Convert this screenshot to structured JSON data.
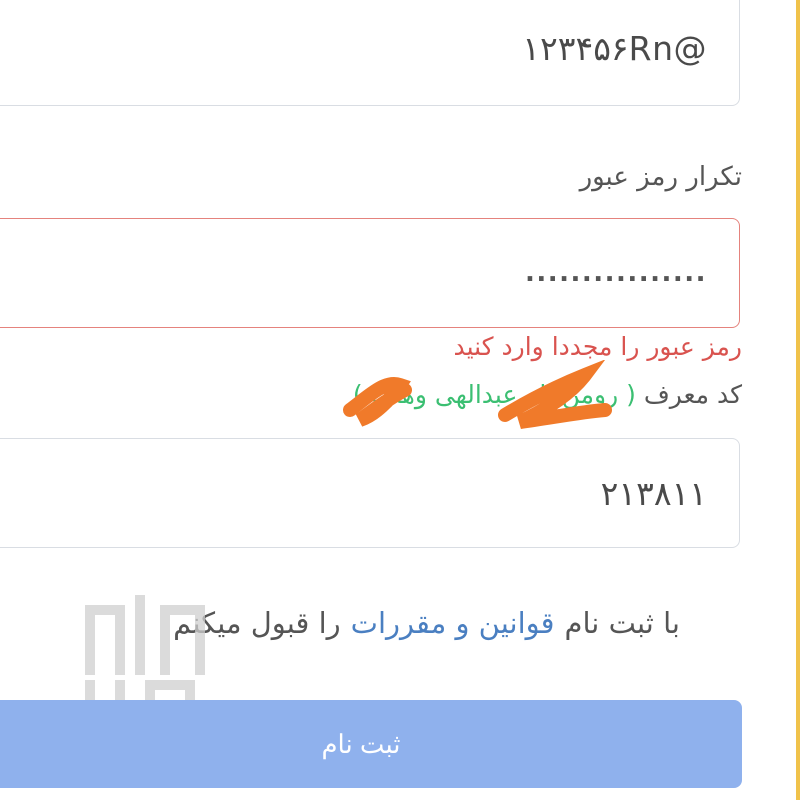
{
  "password": {
    "value": "۱۲۳۴۵۶Rn@"
  },
  "confirm_password": {
    "label": "تکرار رمز عبور",
    "value": "................",
    "error": "رمز عبور را مجددا وارد کنید"
  },
  "referrer": {
    "label": "کد معرف",
    "name": "( رومن‌الله عبدالهی وهاب )",
    "value": "۲۱۳۸۱۱"
  },
  "terms": {
    "prefix": "با ثبت نام",
    "link": "قوانین و مقررات",
    "suffix": "را قبول میکنم"
  },
  "submit": {
    "label": "ثبت نام"
  },
  "watermark": {
    "text": "آپارات مال"
  },
  "colors": {
    "error": "#d9534f",
    "link": "#4a7fc1",
    "accent_green": "#3bbf72",
    "button": "#8fb1ed",
    "redaction": "#f07a2a"
  }
}
